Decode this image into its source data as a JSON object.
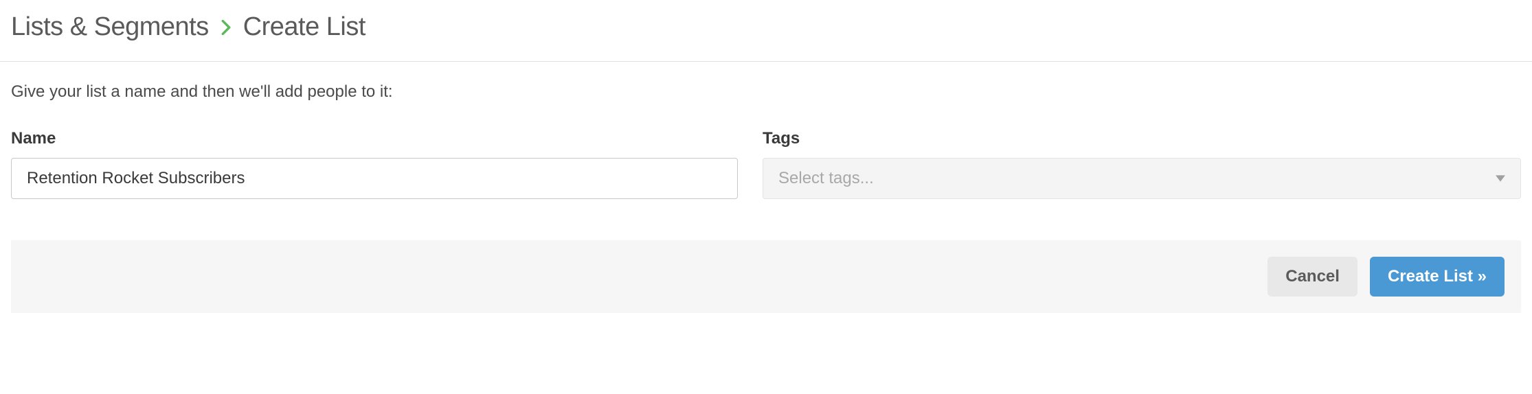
{
  "breadcrumb": {
    "parent": "Lists & Segments",
    "current": "Create List"
  },
  "intro": "Give your list a name and then we'll add people to it:",
  "form": {
    "name": {
      "label": "Name",
      "value": "Retention Rocket Subscribers"
    },
    "tags": {
      "label": "Tags",
      "placeholder": "Select tags..."
    }
  },
  "actions": {
    "cancel": "Cancel",
    "submit": "Create List »"
  }
}
